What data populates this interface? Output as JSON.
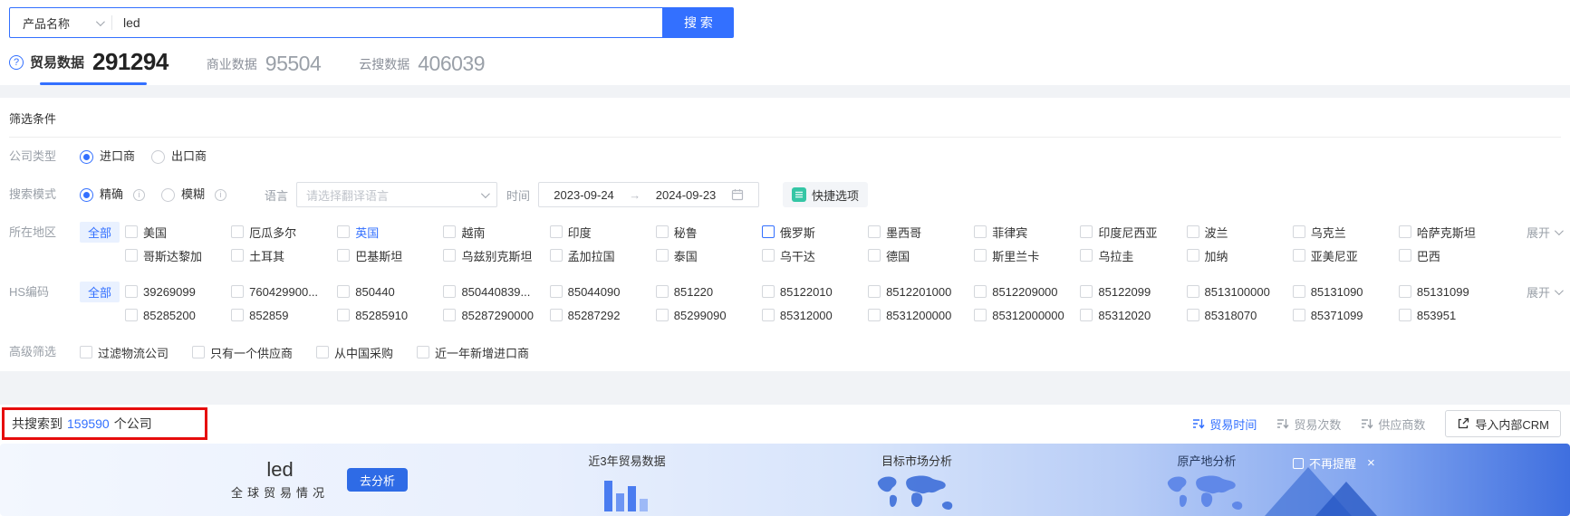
{
  "icons": {
    "question": "?",
    "info": "i",
    "close": "×",
    "arrow_right": "→"
  },
  "search": {
    "category_label": "产品名称",
    "query_value": "led",
    "button_label": "搜 索"
  },
  "tabs": [
    {
      "label": "贸易数据",
      "count": "291294",
      "active": true
    },
    {
      "label": "商业数据",
      "count": "95504",
      "active": false
    },
    {
      "label": "云搜数据",
      "count": "406039",
      "active": false
    }
  ],
  "filter": {
    "section_title": "筛选条件",
    "company_type": {
      "label": "公司类型",
      "option_importer": "进口商",
      "option_exporter": "出口商",
      "selected": "进口商"
    },
    "search_mode": {
      "label": "搜索模式",
      "option_exact": "精确",
      "option_fuzzy": "模糊",
      "selected": "精确",
      "language_label": "语言",
      "language_placeholder": "请选择翻译语言",
      "time_label": "时间",
      "date_start": "2023-09-24",
      "date_end": "2024-09-23",
      "quick_options_label": "快捷选项"
    },
    "region": {
      "label": "所在地区",
      "all_label": "全部",
      "expand_label": "展开",
      "row1": [
        {
          "label": "美国"
        },
        {
          "label": "厄瓜多尔"
        },
        {
          "label": "英国",
          "text_blue": true
        },
        {
          "label": "越南"
        },
        {
          "label": "印度"
        },
        {
          "label": "秘鲁"
        },
        {
          "label": "俄罗斯",
          "box_blue": true
        },
        {
          "label": "墨西哥"
        },
        {
          "label": "菲律宾"
        },
        {
          "label": "印度尼西亚"
        },
        {
          "label": "波兰"
        },
        {
          "label": "乌克兰"
        },
        {
          "label": "哈萨克斯坦"
        }
      ],
      "row2": [
        {
          "label": "哥斯达黎加"
        },
        {
          "label": "土耳其"
        },
        {
          "label": "巴基斯坦"
        },
        {
          "label": "乌兹别克斯坦"
        },
        {
          "label": "孟加拉国"
        },
        {
          "label": "泰国"
        },
        {
          "label": "乌干达"
        },
        {
          "label": "德国"
        },
        {
          "label": "斯里兰卡"
        },
        {
          "label": "乌拉圭"
        },
        {
          "label": "加纳"
        },
        {
          "label": "亚美尼亚"
        },
        {
          "label": "巴西"
        }
      ]
    },
    "hs_code": {
      "label": "HS编码",
      "all_label": "全部",
      "expand_label": "展开",
      "row1": [
        {
          "label": "39269099"
        },
        {
          "label": "760429900..."
        },
        {
          "label": "850440"
        },
        {
          "label": "850440839..."
        },
        {
          "label": "85044090"
        },
        {
          "label": "851220"
        },
        {
          "label": "85122010"
        },
        {
          "label": "8512201000"
        },
        {
          "label": "8512209000"
        },
        {
          "label": "85122099"
        },
        {
          "label": "8513100000"
        },
        {
          "label": "85131090"
        },
        {
          "label": "85131099"
        }
      ],
      "row2": [
        {
          "label": "85285200"
        },
        {
          "label": "852859"
        },
        {
          "label": "85285910"
        },
        {
          "label": "85287290000"
        },
        {
          "label": "85287292"
        },
        {
          "label": "85299090"
        },
        {
          "label": "85312000"
        },
        {
          "label": "8531200000"
        },
        {
          "label": "85312000000"
        },
        {
          "label": "85312020"
        },
        {
          "label": "85318070"
        },
        {
          "label": "85371099"
        },
        {
          "label": "853951"
        }
      ]
    },
    "advanced": {
      "label": "高级筛选",
      "options": [
        {
          "label": "过滤物流公司"
        },
        {
          "label": "只有一个供应商"
        },
        {
          "label": "从中国采购"
        },
        {
          "label": "近一年新增进口商"
        }
      ]
    }
  },
  "results": {
    "summary_prefix": "共搜索到",
    "company_count": "159590",
    "summary_suffix": "个公司",
    "sorts": [
      {
        "label": "贸易时间",
        "active": true
      },
      {
        "label": "贸易次数",
        "active": false
      },
      {
        "label": "供应商数",
        "active": false
      }
    ],
    "crm_button_label": "导入内部CRM"
  },
  "banner": {
    "keyword": "led",
    "subtitle": "全球贸易情况",
    "analyze_label": "去分析",
    "card1_title": "近3年贸易数据",
    "card2_title": "目标市场分析",
    "card3_title": "原产地分析",
    "dismiss_label": "不再提醒"
  },
  "colors": {
    "primary": "#3370ff",
    "quick_icon_green": "#35c6a5",
    "annotation_red": "#e60c0c",
    "banner_blue": "#3f6fdf"
  }
}
